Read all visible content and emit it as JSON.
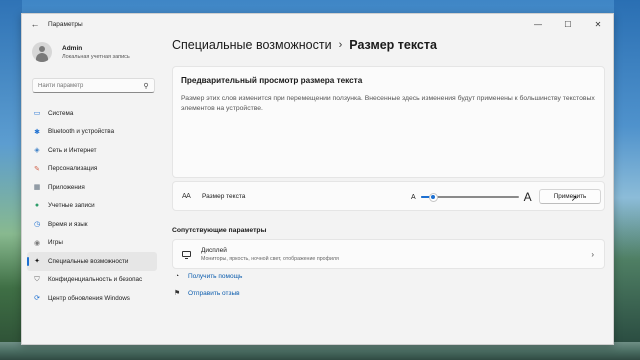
{
  "window": {
    "app_title": "Параметры",
    "controls": {
      "minimize": "—",
      "maximize": "☐",
      "close": "✕"
    }
  },
  "profile": {
    "name": "Admin",
    "subtitle": "Локальная учетная запись"
  },
  "search": {
    "placeholder": "Найти параметр"
  },
  "sidebar": {
    "items": [
      {
        "label": "Система",
        "icon": "system-icon",
        "color": "#1c6fd1"
      },
      {
        "label": "Bluetooth и устройства",
        "icon": "bluetooth-icon",
        "color": "#1c6fd1"
      },
      {
        "label": "Сеть и Интернет",
        "icon": "network-icon",
        "color": "#3c7fc6"
      },
      {
        "label": "Персонализация",
        "icon": "brush-icon",
        "color": "#d1624a"
      },
      {
        "label": "Приложения",
        "icon": "apps-icon",
        "color": "#5a6a7a"
      },
      {
        "label": "Учетные записи",
        "icon": "accounts-icon",
        "color": "#2e9d6a"
      },
      {
        "label": "Время и язык",
        "icon": "time-language-icon",
        "color": "#1c6fd1"
      },
      {
        "label": "Игры",
        "icon": "games-icon",
        "color": "#7a7a7a"
      },
      {
        "label": "Специальные возможности",
        "icon": "accessibility-icon",
        "color": "#1a1a1a"
      },
      {
        "label": "Конфиденциальность и безопас",
        "icon": "shield-icon",
        "color": "#6b6b6b"
      },
      {
        "label": "Центр обновления Windows",
        "icon": "update-icon",
        "color": "#1c6fd1"
      }
    ],
    "active_index": 8
  },
  "header": {
    "parent": "Специальные возможности",
    "separator": "›",
    "current": "Размер текста"
  },
  "preview": {
    "title": "Предварительный просмотр размера текста",
    "text": "Размер этих слов изменится при перемещении ползунка. Внесенные здесь изменения будут применены к большинству текстовых элементов на устройстве."
  },
  "text_size": {
    "icon_text": "AA",
    "label": "Размер текста",
    "slider_small": "A",
    "slider_big": "A",
    "slider_level": 0.13,
    "apply_label": "Применить"
  },
  "related": {
    "title": "Сопутствующие параметры",
    "display_name": "Дисплей",
    "display_sub": "Мониторы, яркость, ночной свет, отображение профиля",
    "chevron": "›"
  },
  "links": {
    "help": "Получить помощь",
    "feedback": "Отправить отзыв"
  },
  "colors": {
    "accent": "#1c6fd1",
    "link": "#0b5cad"
  }
}
